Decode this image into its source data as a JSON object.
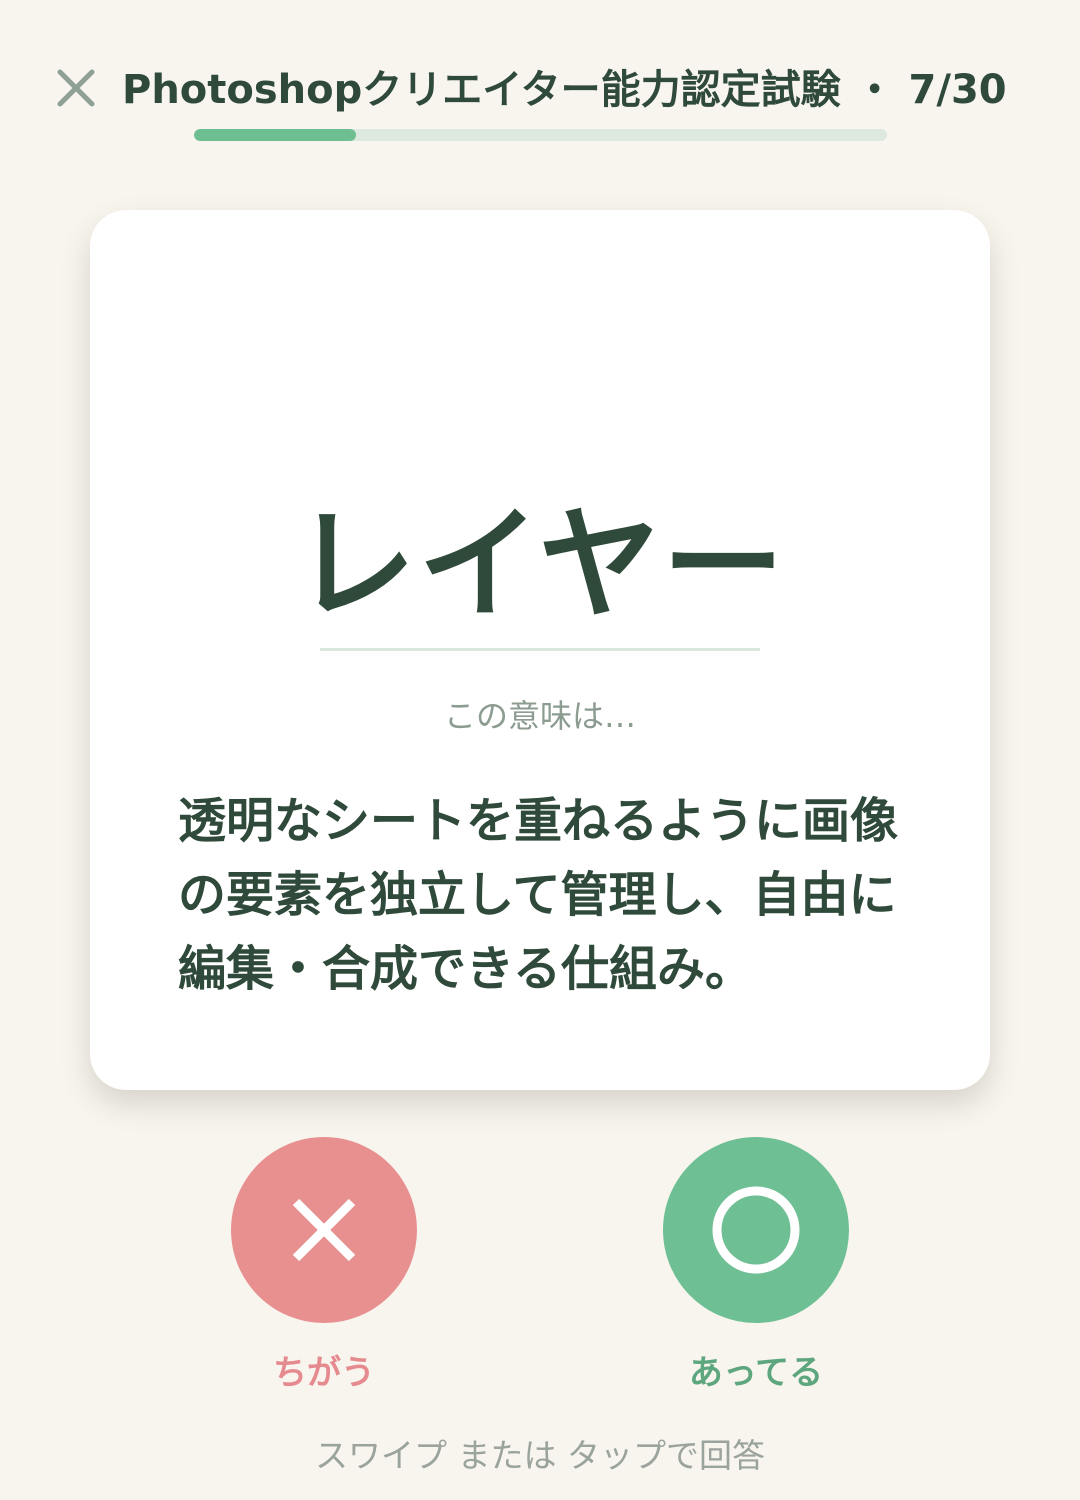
{
  "header": {
    "close_icon": "close-icon",
    "title": "Photoshopクリエイター能力認定試験 ・ 7/30",
    "progress": {
      "current": 7,
      "total": 30
    }
  },
  "card": {
    "term": "レイヤー",
    "prompt": "この意味は…",
    "definition": "透明なシートを重ねるように画像の要素を独立して管理し、自由に編集・合成できる仕組み。"
  },
  "answers": {
    "wrong": {
      "label": "ちがう",
      "icon": "cross-icon",
      "color": "#e89090"
    },
    "right": {
      "label": "あってる",
      "icon": "circle-icon",
      "color": "#6fbf94"
    }
  },
  "hint": "スワイプ または タップで回答",
  "colors": {
    "background": "#f8f5ee",
    "text": "#2f4a3a",
    "progress_fill": "#6dbf92",
    "progress_track": "#dde9df"
  }
}
